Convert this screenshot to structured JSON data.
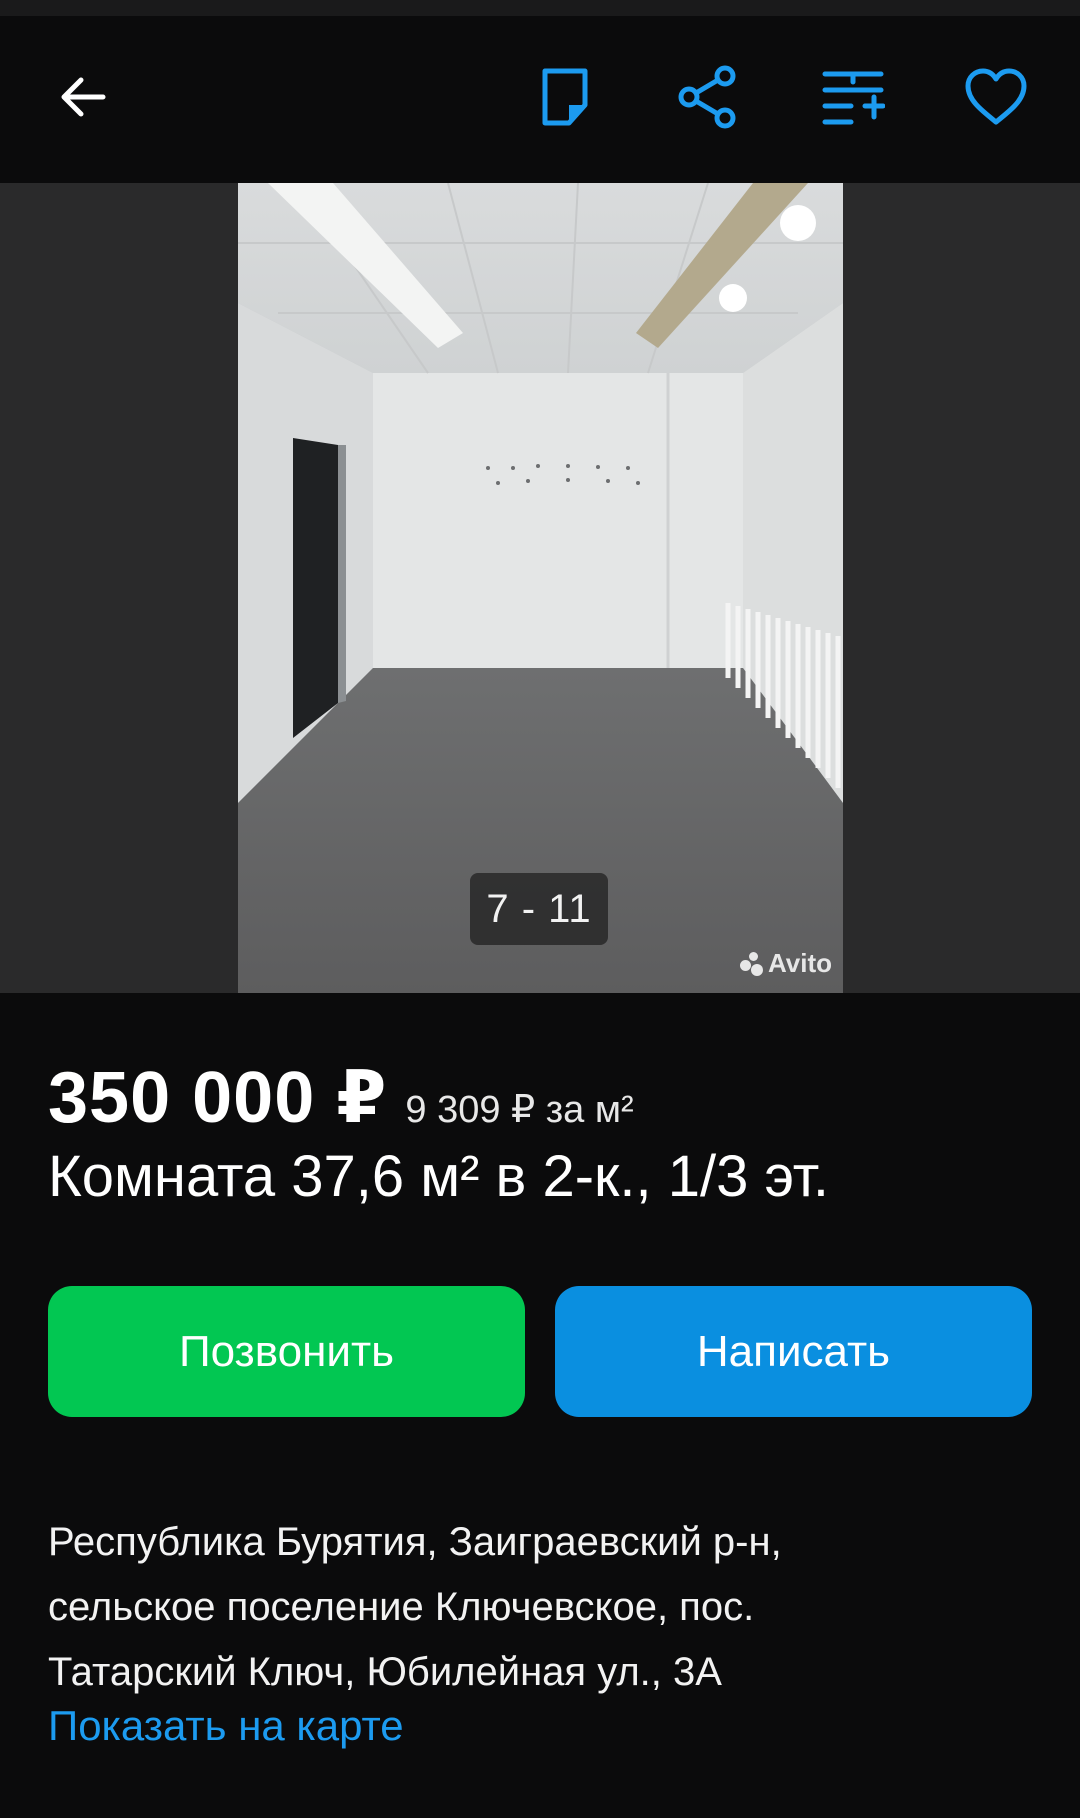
{
  "header": {
    "back_icon": "arrow-left-icon",
    "note_icon": "note-icon",
    "share_icon": "share-icon",
    "compare_icon": "compare-list-add-icon",
    "favorite_icon": "heart-icon",
    "accent_color": "#1c9bf0"
  },
  "gallery": {
    "counter": "7 - 11",
    "watermark": "Avito"
  },
  "listing": {
    "price": "350 000 ₽",
    "price_per_m2": "9 309 ₽ за м²",
    "title": "Комната 37,6 м² в 2-к., 1/3 эт."
  },
  "actions": {
    "call_label": "Позвонить",
    "call_color": "#02c752",
    "write_label": "Написать",
    "write_color": "#0a8fe0"
  },
  "location": {
    "address_line1": "Республика Бурятия, Заиграевский р-н,",
    "address_line2": "сельское поселение Ключевское, пос.",
    "address_line3": "Татарский Ключ, Юбилейная ул., 3А",
    "map_link": "Показать на карте"
  }
}
